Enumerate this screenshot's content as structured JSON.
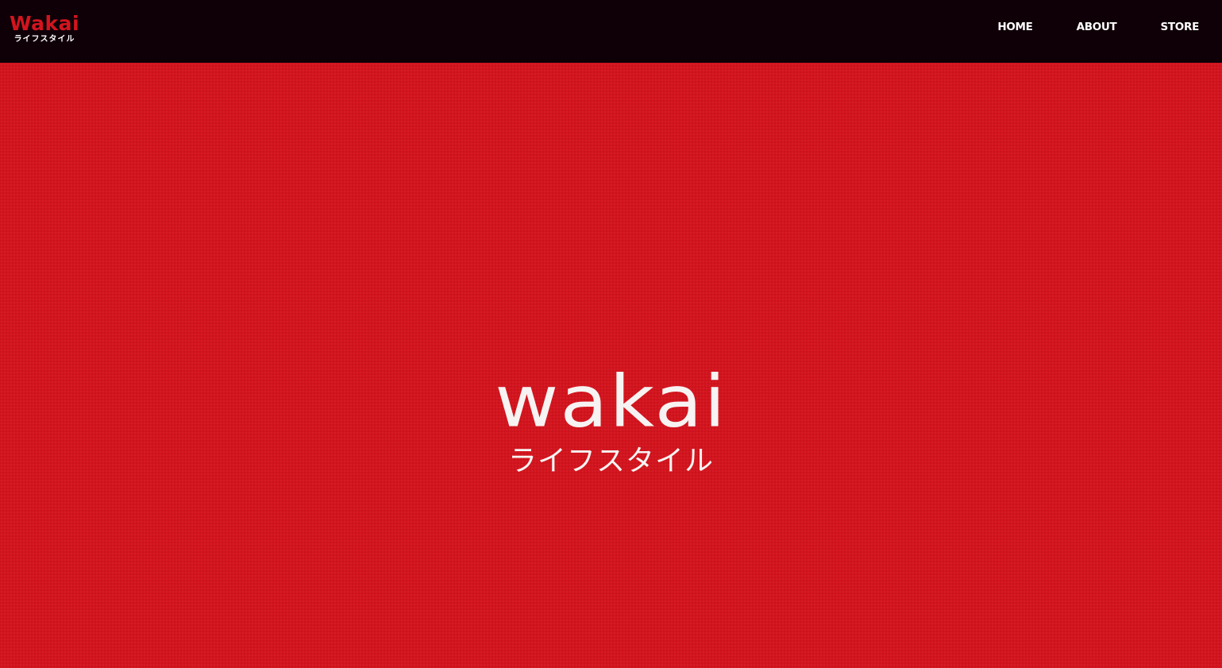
{
  "colors": {
    "navbar_bg": "#0f0008",
    "brand_red": "#d3141e",
    "hero_bg": "#d3141e",
    "text_white": "#ffffff"
  },
  "header": {
    "brand": {
      "name": "Wakai",
      "subtitle": "ライフスタイル"
    },
    "nav": {
      "items": [
        {
          "label": "HOME"
        },
        {
          "label": "ABOUT"
        },
        {
          "label": "STORE"
        }
      ]
    }
  },
  "hero": {
    "logo_name": "wakai",
    "logo_subtitle": "ライフスタイル"
  }
}
